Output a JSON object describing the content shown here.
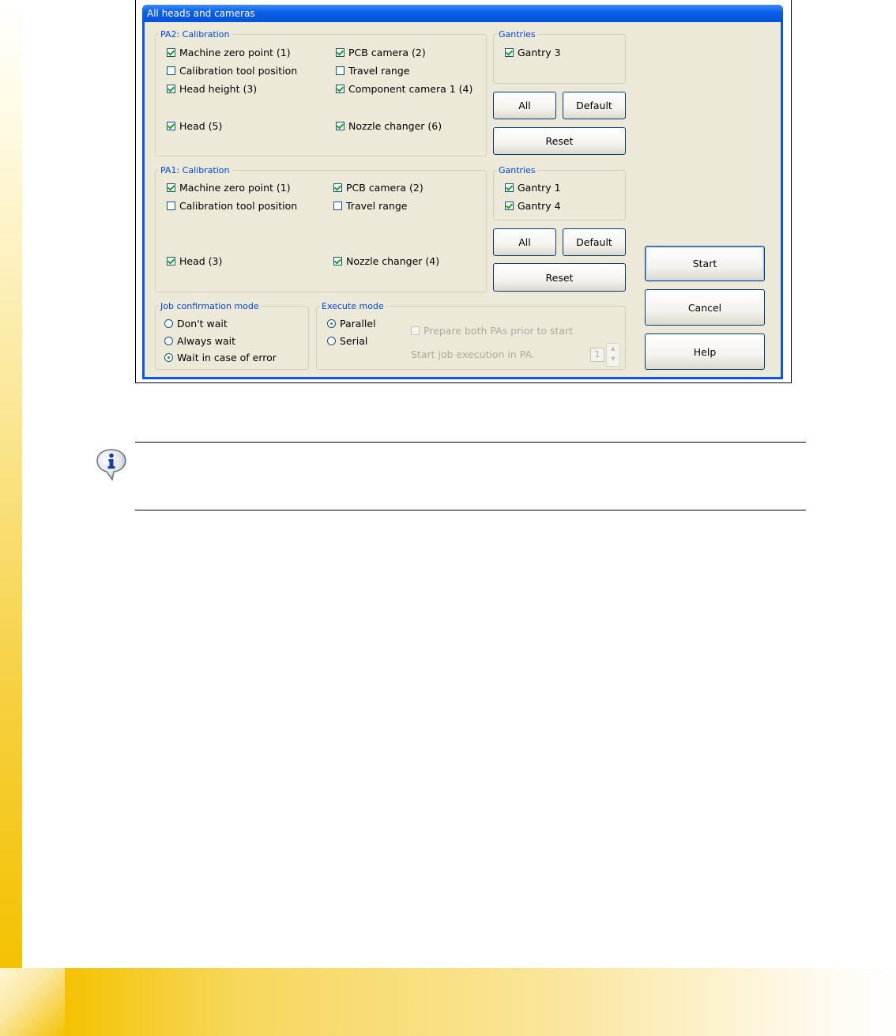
{
  "window": {
    "title": "All heads and cameras"
  },
  "pa2": {
    "legend": "PA2: Calibration",
    "items": [
      {
        "label": "Machine zero point (1)",
        "checked": true
      },
      {
        "label": "PCB camera (2)",
        "checked": true
      },
      {
        "label": "Calibration tool position",
        "checked": false
      },
      {
        "label": "Travel range",
        "checked": false
      },
      {
        "label": "Head height (3)",
        "checked": true
      },
      {
        "label": "Component camera 1 (4)",
        "checked": true
      },
      {
        "label": "Head (5)",
        "checked": true
      },
      {
        "label": "Nozzle changer (6)",
        "checked": true
      }
    ],
    "gantries": {
      "legend": "Gantries",
      "items": [
        {
          "label": "Gantry 3",
          "checked": true
        }
      ]
    },
    "buttons": {
      "all": "All",
      "default": "Default",
      "reset": "Reset"
    }
  },
  "pa1": {
    "legend": "PA1: Calibration",
    "items": [
      {
        "label": "Machine zero point (1)",
        "checked": true
      },
      {
        "label": "PCB camera (2)",
        "checked": true
      },
      {
        "label": "Calibration tool position",
        "checked": false
      },
      {
        "label": "Travel range",
        "checked": false
      },
      {
        "label": "Head (3)",
        "checked": true
      },
      {
        "label": "Nozzle changer (4)",
        "checked": true
      }
    ],
    "gantries": {
      "legend": "Gantries",
      "items": [
        {
          "label": "Gantry 1",
          "checked": true
        },
        {
          "label": "Gantry 4",
          "checked": true
        }
      ]
    },
    "buttons": {
      "all": "All",
      "default": "Default",
      "reset": "Reset"
    }
  },
  "job_confirmation": {
    "legend": "Job confirmation mode",
    "options": [
      {
        "label": "Don't wait",
        "selected": false
      },
      {
        "label": "Always wait",
        "selected": false
      },
      {
        "label": "Wait in case of error",
        "selected": true
      }
    ]
  },
  "execute_mode": {
    "legend": "Execute mode",
    "options": [
      {
        "label": "Parallel",
        "selected": true
      },
      {
        "label": "Serial",
        "selected": false
      }
    ],
    "prepare_both": {
      "label": "Prepare both PAs prior to start",
      "checked": false,
      "enabled": false
    },
    "start_in_pa": {
      "label": "Start job execution in PA.",
      "value": "1",
      "enabled": false
    }
  },
  "actions": {
    "start": "Start",
    "cancel": "Cancel",
    "help": "Help"
  },
  "note": {
    "icon": "info-icon"
  },
  "colors": {
    "title_bar": "#0a5ee8",
    "dialog_bg": "#ece9d8",
    "legend": "#0046d5",
    "accent_yellow": "#f4c200"
  }
}
